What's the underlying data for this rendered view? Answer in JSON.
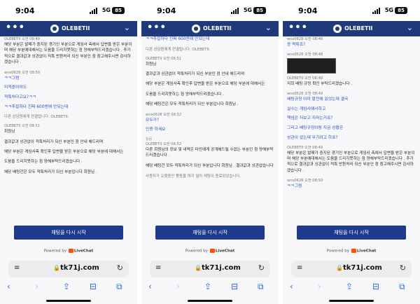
{
  "panels": [
    {
      "status": {
        "time": "9:04",
        "network": "5G",
        "battery": "85"
      },
      "header": {
        "brand": "OLEBETII",
        "menu_icon": "more-dots-icon",
        "chevron_icon": "chevron-down-icon"
      },
      "messages": [
        {
          "type": "meta",
          "text": "OLEBETII 오전 08:49"
        },
        {
          "type": "plain",
          "text": "해당 부분은 발매가 중지된 경기인 부분으로 게임사 측에서 답변을 받은 부분이며 해당 부분에대해서는 도움을 드리지못하는 점 양해부탁드리겠습니다 . 추가적으로 결과값과 상관없이 적특 반환처리 되신 부분인 점 참고해주시면 감사하겠습니다 ."
        },
        {
          "type": "meta",
          "text": "wns0628 오전 08:50"
        },
        {
          "type": "link",
          "text": "ㅋㅋ그럼"
        },
        {
          "type": "link",
          "text": "미적중이어도"
        },
        {
          "type": "link",
          "text": "적특처다고요?ㅋㅋ"
        },
        {
          "type": "link",
          "text": "ㅋㅋ추잡하다 진짜 600엔에 안되는데"
        },
        {
          "type": "sys",
          "text": "다른 상담원에게 연결됩니다: OLEBETII."
        },
        {
          "type": "meta",
          "text": "OLEBETII 오전 08:51"
        },
        {
          "type": "plain",
          "text": "회원님"
        },
        {
          "type": "plain",
          "text": "결과값과 상관없이 적특처리가 되신 부분인 점 안내 해드리며"
        },
        {
          "type": "plain",
          "text": "해당 부분은 게임사측 확인후 답변을 받은 부분으로 해당 부분에 대해서는"
        },
        {
          "type": "plain",
          "text": "도움을 드리지못하는 점 양해부탁드리겠습니다 ."
        },
        {
          "type": "plain",
          "text": "해당 배팅건은 모두 적특처리가 되신 부분입니다 회원님 ."
        }
      ],
      "restart_label": "채팅을 다시 시작",
      "powered_by": "Powered by",
      "livechat": "LiveChat",
      "url": "tk71j.com"
    },
    {
      "status": {
        "time": "9:04",
        "network": "5G",
        "battery": "85"
      },
      "header": {
        "brand": "OLEBETII",
        "menu_icon": "more-dots-icon",
        "chevron_icon": "chevron-down-icon"
      },
      "messages": [
        {
          "type": "link",
          "text": "ㅋㅋ추잡하다 진짜 600엔에 안되는데"
        },
        {
          "type": "sys",
          "text": "다른 상담원에게 연결됩니다: OLEBETII."
        },
        {
          "type": "meta",
          "text": "OLEBETII 오전 08:51"
        },
        {
          "type": "plain",
          "text": "회원님"
        },
        {
          "type": "plain",
          "text": "결과값과 상관없이 적특처리가 되신 부분인 점 안내 해드리며"
        },
        {
          "type": "plain",
          "text": "해당 부분은 게임사측 확인후 답변을 받은 부분으로 해당 부분에 대해서는"
        },
        {
          "type": "plain",
          "text": "도움을 드리지못하는 점 양해부탁드리겠습니다 ."
        },
        {
          "type": "plain",
          "text": "해당 배팅건은 모두 적특처리가 되신 부분입니다 회원님 ."
        },
        {
          "type": "meta",
          "text": "wns0628 오전 08:52"
        },
        {
          "type": "link",
          "text": "모두가?"
        },
        {
          "type": "link",
          "text": "인증 하세요"
        },
        {
          "type": "muted",
          "text": "읽음"
        },
        {
          "type": "meta",
          "text": "OLEBETII 오전 08:52"
        },
        {
          "type": "plain",
          "text": "다른 회원님의 정보 및 내역은 타인에게 공개해드릴 수없는 부분인 점 양해부탁드리겠습니다 ."
        },
        {
          "type": "plain",
          "text": "해당 배팅건 모두 적특처리가 되신 부분입니다 회원님 . 결과값과 상관없습니다"
        },
        {
          "type": "sys",
          "text": "사용자가 오랫동안 활동을 하지 않아 채팅이 종료되었습니다."
        }
      ],
      "restart_label": "채팅을 다시 시작",
      "powered_by": "Powered by",
      "livechat": "LiveChat",
      "url": "tk71j.com"
    },
    {
      "status": {
        "time": "9:04",
        "network": "5G",
        "battery": "85"
      },
      "header": {
        "brand": "OLEBETII",
        "menu_icon": "more-dots-icon",
        "chevron_icon": "chevron-down-icon"
      },
      "messages": [
        {
          "type": "meta",
          "text": "wns0628 오전 08:48"
        },
        {
          "type": "link",
          "text": "응 먹튀죠?"
        },
        {
          "type": "meta",
          "text": "wns0628 오전 08:48"
        },
        {
          "type": "image",
          "text": ""
        },
        {
          "type": "meta",
          "text": "OLEBETII 오전 08:48"
        },
        {
          "type": "plain",
          "text": "저희 배팅 규정 확인 부탁드리겠습니다 ."
        },
        {
          "type": "meta",
          "text": "wns0628 오전 08:49"
        },
        {
          "type": "link",
          "text": "배팅규정 이미 말전에 읽었는데 결국"
        },
        {
          "type": "link",
          "text": "실수는 게임사에서하고"
        },
        {
          "type": "link",
          "text": "책임은 저보고 지라는거죠?"
        },
        {
          "type": "link",
          "text": "그리고 배팅규정이랑 지금 상황은"
        },
        {
          "type": "link",
          "text": "상관이 없는데 무기려고 하죠?"
        },
        {
          "type": "meta",
          "text": "OLEBETII 오전 08:49"
        },
        {
          "type": "plain",
          "text": "해당 부분은 발매가 중지된 경기인 부분으로 게임사 측에서 답변을 받은 부분이며 해당 부분에대해서는 도움을 드리지못하는 점 양해부탁드리겠습니다 . 추가적으로 결과값과 상관없이 적특 반환처리 되신 부분인 점 참고해주시면 감사하겠습니다 ."
        },
        {
          "type": "meta",
          "text": "wns0628 오전 08:50"
        },
        {
          "type": "link",
          "text": "ㅋㅋ그럼"
        }
      ],
      "restart_label": "채팅을 다시 시작",
      "powered_by": "Powered by",
      "livechat": "LiveChat",
      "url": "tk71j.com"
    }
  ]
}
